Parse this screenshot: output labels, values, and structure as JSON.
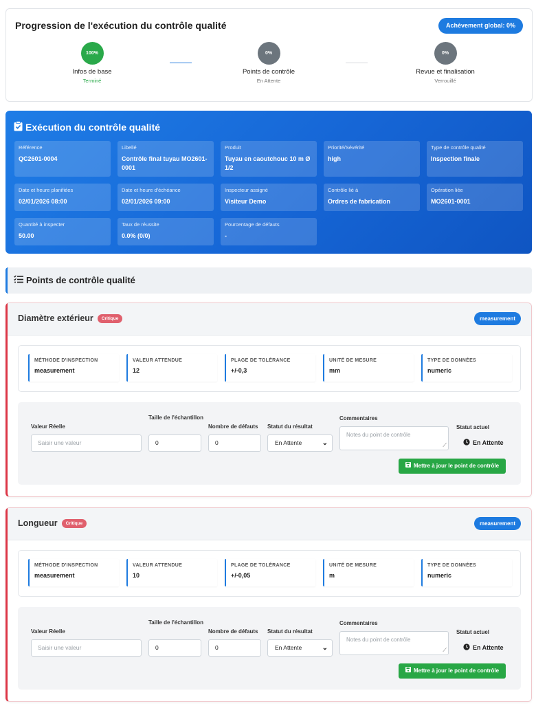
{
  "progress": {
    "title": "Progression de l'exécution du contrôle qualité",
    "global_label": "Achèvement global: 0%",
    "steps": [
      {
        "badge": "100%",
        "name": "Infos de base",
        "status": "Terminé",
        "state": "done"
      },
      {
        "badge": "0%",
        "name": "Points de contrôle",
        "status": "En Attente",
        "state": "pending"
      },
      {
        "badge": "0%",
        "name": "Revue et finalisation",
        "status": "Verrouillé",
        "state": "locked"
      }
    ]
  },
  "execution": {
    "title": "Exécution du contrôle qualité",
    "fields": [
      {
        "label": "Référence",
        "value": "QC2601-0004"
      },
      {
        "label": "Libellé",
        "value": "Contrôle final tuyau MO2601-0001"
      },
      {
        "label": "Produit",
        "value": "Tuyau en caoutchouc 10 m Ø 1/2"
      },
      {
        "label": "Priorité/Sévérité",
        "value": "high"
      },
      {
        "label": "Type de contrôle qualité",
        "value": "Inspection finale"
      },
      {
        "label": "Date et heure planifiées",
        "value": "02/01/2026 08:00"
      },
      {
        "label": "Date et heure d'échéance",
        "value": "02/01/2026 09:00"
      },
      {
        "label": "Inspecteur assigné",
        "value": "Visiteur Demo"
      },
      {
        "label": "Contrôle lié à",
        "value": "Ordres de fabrication"
      },
      {
        "label": "Opération liée",
        "value": "MO2601-0001"
      },
      {
        "label": "Quantité à inspecter",
        "value": "50.00"
      },
      {
        "label": "Taux de réussite",
        "value": "0.0% (0/0)"
      },
      {
        "label": "Pourcentage de défauts",
        "value": "-"
      }
    ]
  },
  "checkpoints_header": "Points de contrôle qualité",
  "checkpoints": [
    {
      "name": "Diamètre extérieur",
      "criticality": "Critique",
      "type_badge": "measurement",
      "specs": [
        {
          "label": "MÉTHODE D'INSPECTION",
          "value": "measurement"
        },
        {
          "label": "VALEUR ATTENDUE",
          "value": "12"
        },
        {
          "label": "PLAGE DE TOLÉRANCE",
          "value": "+/-0,3"
        },
        {
          "label": "UNITÉ DE MESURE",
          "value": "mm"
        },
        {
          "label": "TYPE DE DONNÉES",
          "value": "numeric"
        }
      ],
      "form": {
        "actual_label": "Valeur Réelle",
        "actual_placeholder": "Saisir une valeur",
        "sample_label": "Taille de l'échantillon",
        "sample_value": "0",
        "defects_label": "Nombre de défauts",
        "defects_value": "0",
        "result_label": "Statut du résultat",
        "result_value": "En Attente",
        "comments_label": "Commentaires",
        "comments_placeholder": "Notes du point de contrôle",
        "current_label": "Statut actuel",
        "current_value": "En Attente",
        "save_label": "Mettre à jour le point de contrôle"
      }
    },
    {
      "name": "Longueur",
      "criticality": "Critique",
      "type_badge": "measurement",
      "specs": [
        {
          "label": "MÉTHODE D'INSPECTION",
          "value": "measurement"
        },
        {
          "label": "VALEUR ATTENDUE",
          "value": "10"
        },
        {
          "label": "PLAGE DE TOLÉRANCE",
          "value": "+/-0,05"
        },
        {
          "label": "UNITÉ DE MESURE",
          "value": "m"
        },
        {
          "label": "TYPE DE DONNÉES",
          "value": "numeric"
        }
      ],
      "form": {
        "actual_label": "Valeur Réelle",
        "actual_placeholder": "Saisir une valeur",
        "sample_label": "Taille de l'échantillon",
        "sample_value": "0",
        "defects_label": "Nombre de défauts",
        "defects_value": "0",
        "result_label": "Statut du résultat",
        "result_value": "En Attente",
        "comments_label": "Commentaires",
        "comments_placeholder": "Notes du point de contrôle",
        "current_label": "Statut actuel",
        "current_value": "En Attente",
        "save_label": "Mettre à jour le point de contrôle"
      }
    }
  ],
  "colors": {
    "primary": "#1e7be0",
    "success": "#28a745",
    "step_done": "#2aa94a",
    "step_pending": "#6c757d",
    "critical": "#dc3545"
  }
}
